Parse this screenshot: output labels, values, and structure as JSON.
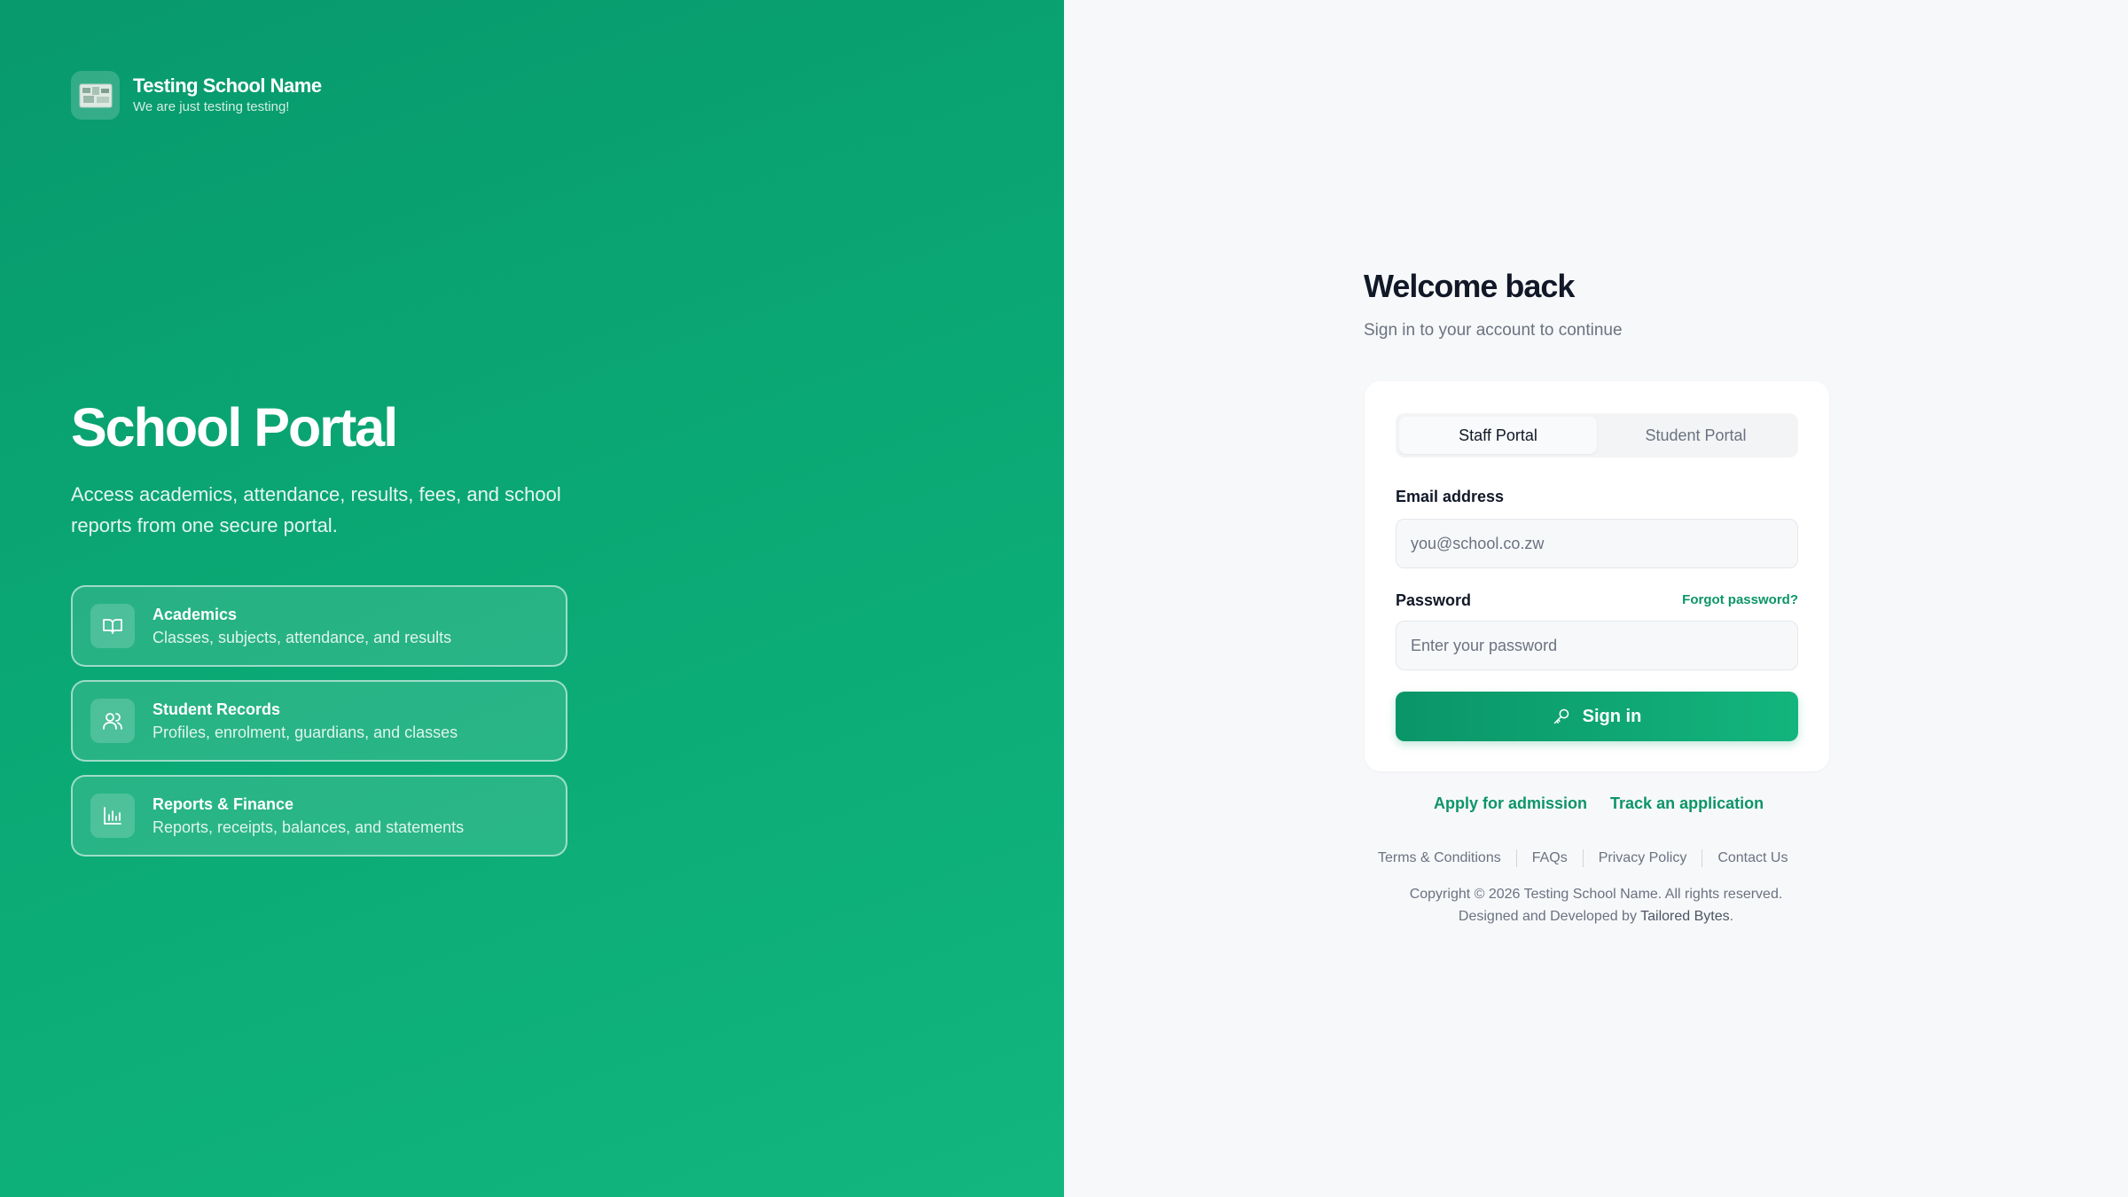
{
  "brand": {
    "name": "Testing School Name",
    "tagline": "We are just testing testing!"
  },
  "hero": {
    "title": "School Portal",
    "description": "Access academics, attendance, results, fees, and school reports from one secure portal."
  },
  "features": [
    {
      "title": "Academics",
      "subtitle": "Classes, subjects, attendance, and results",
      "icon": "book-icon"
    },
    {
      "title": "Student Records",
      "subtitle": "Profiles, enrolment, guardians, and classes",
      "icon": "users-icon"
    },
    {
      "title": "Reports & Finance",
      "subtitle": "Reports, receipts, balances, and statements",
      "icon": "bar-chart-icon"
    }
  ],
  "login": {
    "title": "Welcome back",
    "subtitle": "Sign in to your account to continue",
    "tabs": [
      {
        "label": "Staff Portal",
        "active": true
      },
      {
        "label": "Student Portal",
        "active": false
      }
    ],
    "email_label": "Email address",
    "email_placeholder": "you@school.co.zw",
    "password_label": "Password",
    "password_placeholder": "Enter your password",
    "forgot_label": "Forgot password?",
    "signin_label": "Sign in",
    "signin_icon": "key-icon"
  },
  "links": {
    "apply": "Apply for admission",
    "track": "Track an application"
  },
  "footer": {
    "links": [
      "Terms & Conditions",
      "FAQs",
      "Privacy Policy",
      "Contact Us"
    ],
    "copyright": "Copyright © 2026 Testing School Name. All rights reserved.",
    "credit_prefix": "Designed and Developed by",
    "credit_name": "Tailored Bytes",
    "credit_suffix": "."
  },
  "colors": {
    "brand_green": "#0c9567",
    "hero_start": "#08996c",
    "hero_end": "#12b67e",
    "text_dark": "#111827",
    "text_muted": "#6b7280"
  }
}
